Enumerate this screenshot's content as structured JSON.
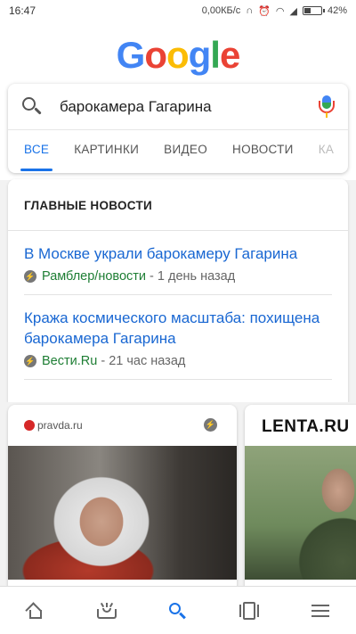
{
  "status_bar": {
    "time": "16:47",
    "network_speed": "0,00КБ/с",
    "battery": "42%",
    "battery_level": 0.42
  },
  "logo": {
    "letters": [
      "G",
      "o",
      "o",
      "g",
      "l",
      "e"
    ],
    "colors": [
      "#4285f4",
      "#ea4335",
      "#fbbc05",
      "#4285f4",
      "#34a853",
      "#ea4335"
    ]
  },
  "search": {
    "query": "барокамера Гагарина"
  },
  "tabs": [
    {
      "label": "ВСЕ",
      "active": true
    },
    {
      "label": "КАРТИНКИ",
      "active": false
    },
    {
      "label": "ВИДЕО",
      "active": false
    },
    {
      "label": "НОВОСТИ",
      "active": false
    },
    {
      "label": "КА",
      "active": false
    }
  ],
  "top_news": {
    "heading": "ГЛАВНЫЕ НОВОСТИ",
    "items": [
      {
        "title": "В Москве украли барокамеру Гагарина",
        "source": "Рамблер/новости",
        "separator": "-",
        "time": "1 день назад"
      },
      {
        "title": "Кража космического масштаба: похищена барокамера Гагарина",
        "source": "Вести.Ru",
        "separator": "-",
        "time": "21 час назад"
      }
    ]
  },
  "carousel": {
    "cards": [
      {
        "publisher": "pravda.ru",
        "amp_icon": "bolt-icon"
      },
      {
        "publisher": "LENTA.RU"
      }
    ]
  },
  "bottom_nav": {
    "items": [
      "home-icon",
      "updates-icon",
      "search-icon",
      "tabs-icon",
      "menu-icon"
    ],
    "accent": "#1a73e8"
  }
}
